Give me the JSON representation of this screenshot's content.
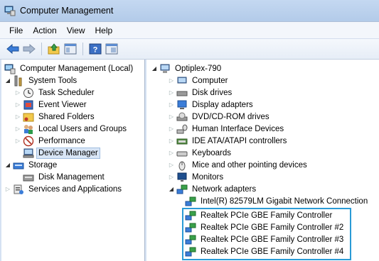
{
  "window": {
    "title": "Computer Management"
  },
  "menu": [
    "File",
    "Action",
    "View",
    "Help"
  ],
  "toolbar": {
    "icons": [
      "back-arrow-icon",
      "forward-arrow-icon",
      "up-folder-icon",
      "console-tree-icon",
      "help-icon",
      "properties-icon"
    ]
  },
  "left_tree": {
    "root": "Computer Management (Local)",
    "system_tools": "System Tools",
    "task_scheduler": "Task Scheduler",
    "event_viewer": "Event Viewer",
    "shared_folders": "Shared Folders",
    "local_users": "Local Users and Groups",
    "performance": "Performance",
    "device_manager": "Device Manager",
    "storage": "Storage",
    "disk_management": "Disk Management",
    "services": "Services and Applications"
  },
  "right_tree": {
    "root": "Optiplex-790",
    "categories": [
      "Computer",
      "Disk drives",
      "Display adapters",
      "DVD/CD-ROM drives",
      "Human Interface Devices",
      "IDE ATA/ATAPI controllers",
      "Keyboards",
      "Mice and other pointing devices",
      "Monitors",
      "Network adapters"
    ],
    "network_adapters": [
      "Intel(R) 82579LM Gigabit Network Connection",
      "Realtek PCIe GBE Family Controller",
      "Realtek PCIe GBE Family Controller #2",
      "Realtek PCIe GBE Family Controller #3",
      "Realtek PCIe GBE Family Controller #4"
    ]
  },
  "colors": {
    "highlight_box": "#2a9bd6",
    "selection": "#d9e6f6"
  }
}
